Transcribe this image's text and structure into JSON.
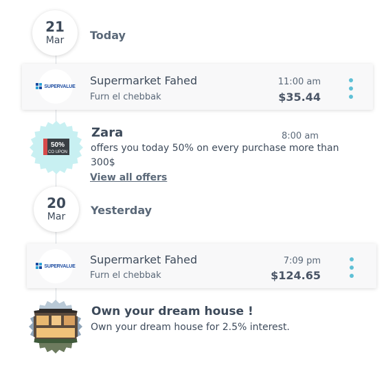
{
  "groups": [
    {
      "day": "21",
      "month": "Mar",
      "label": "Today"
    },
    {
      "day": "20",
      "month": "Mar",
      "label": "Yesterday"
    }
  ],
  "transactions": [
    {
      "merchant": "Supermarket Fahed",
      "location": "Furn el chebbak",
      "time": "11:00 am",
      "amount": "$35.44",
      "logo_text": "SUPERVALUE"
    },
    {
      "merchant": "Supermarket Fahed",
      "location": "Furn el chebbak",
      "time": "7:09 pm",
      "amount": "$124.65",
      "logo_text": "SUPERVALUE"
    }
  ],
  "offer": {
    "badge_top": "50%",
    "badge_bottom": "CO UPON",
    "title": "Zara",
    "time": "8:00 am",
    "text": "offers you today 50% on every purchase more than 300$",
    "link": "View all offers"
  },
  "promo": {
    "title": "Own your dream house !",
    "text": "Own your dream house for 2.5% interest."
  },
  "colors": {
    "accent": "#5fc0d6",
    "text": "#3d4a5a",
    "badge_bg": "#c8f0f2"
  }
}
